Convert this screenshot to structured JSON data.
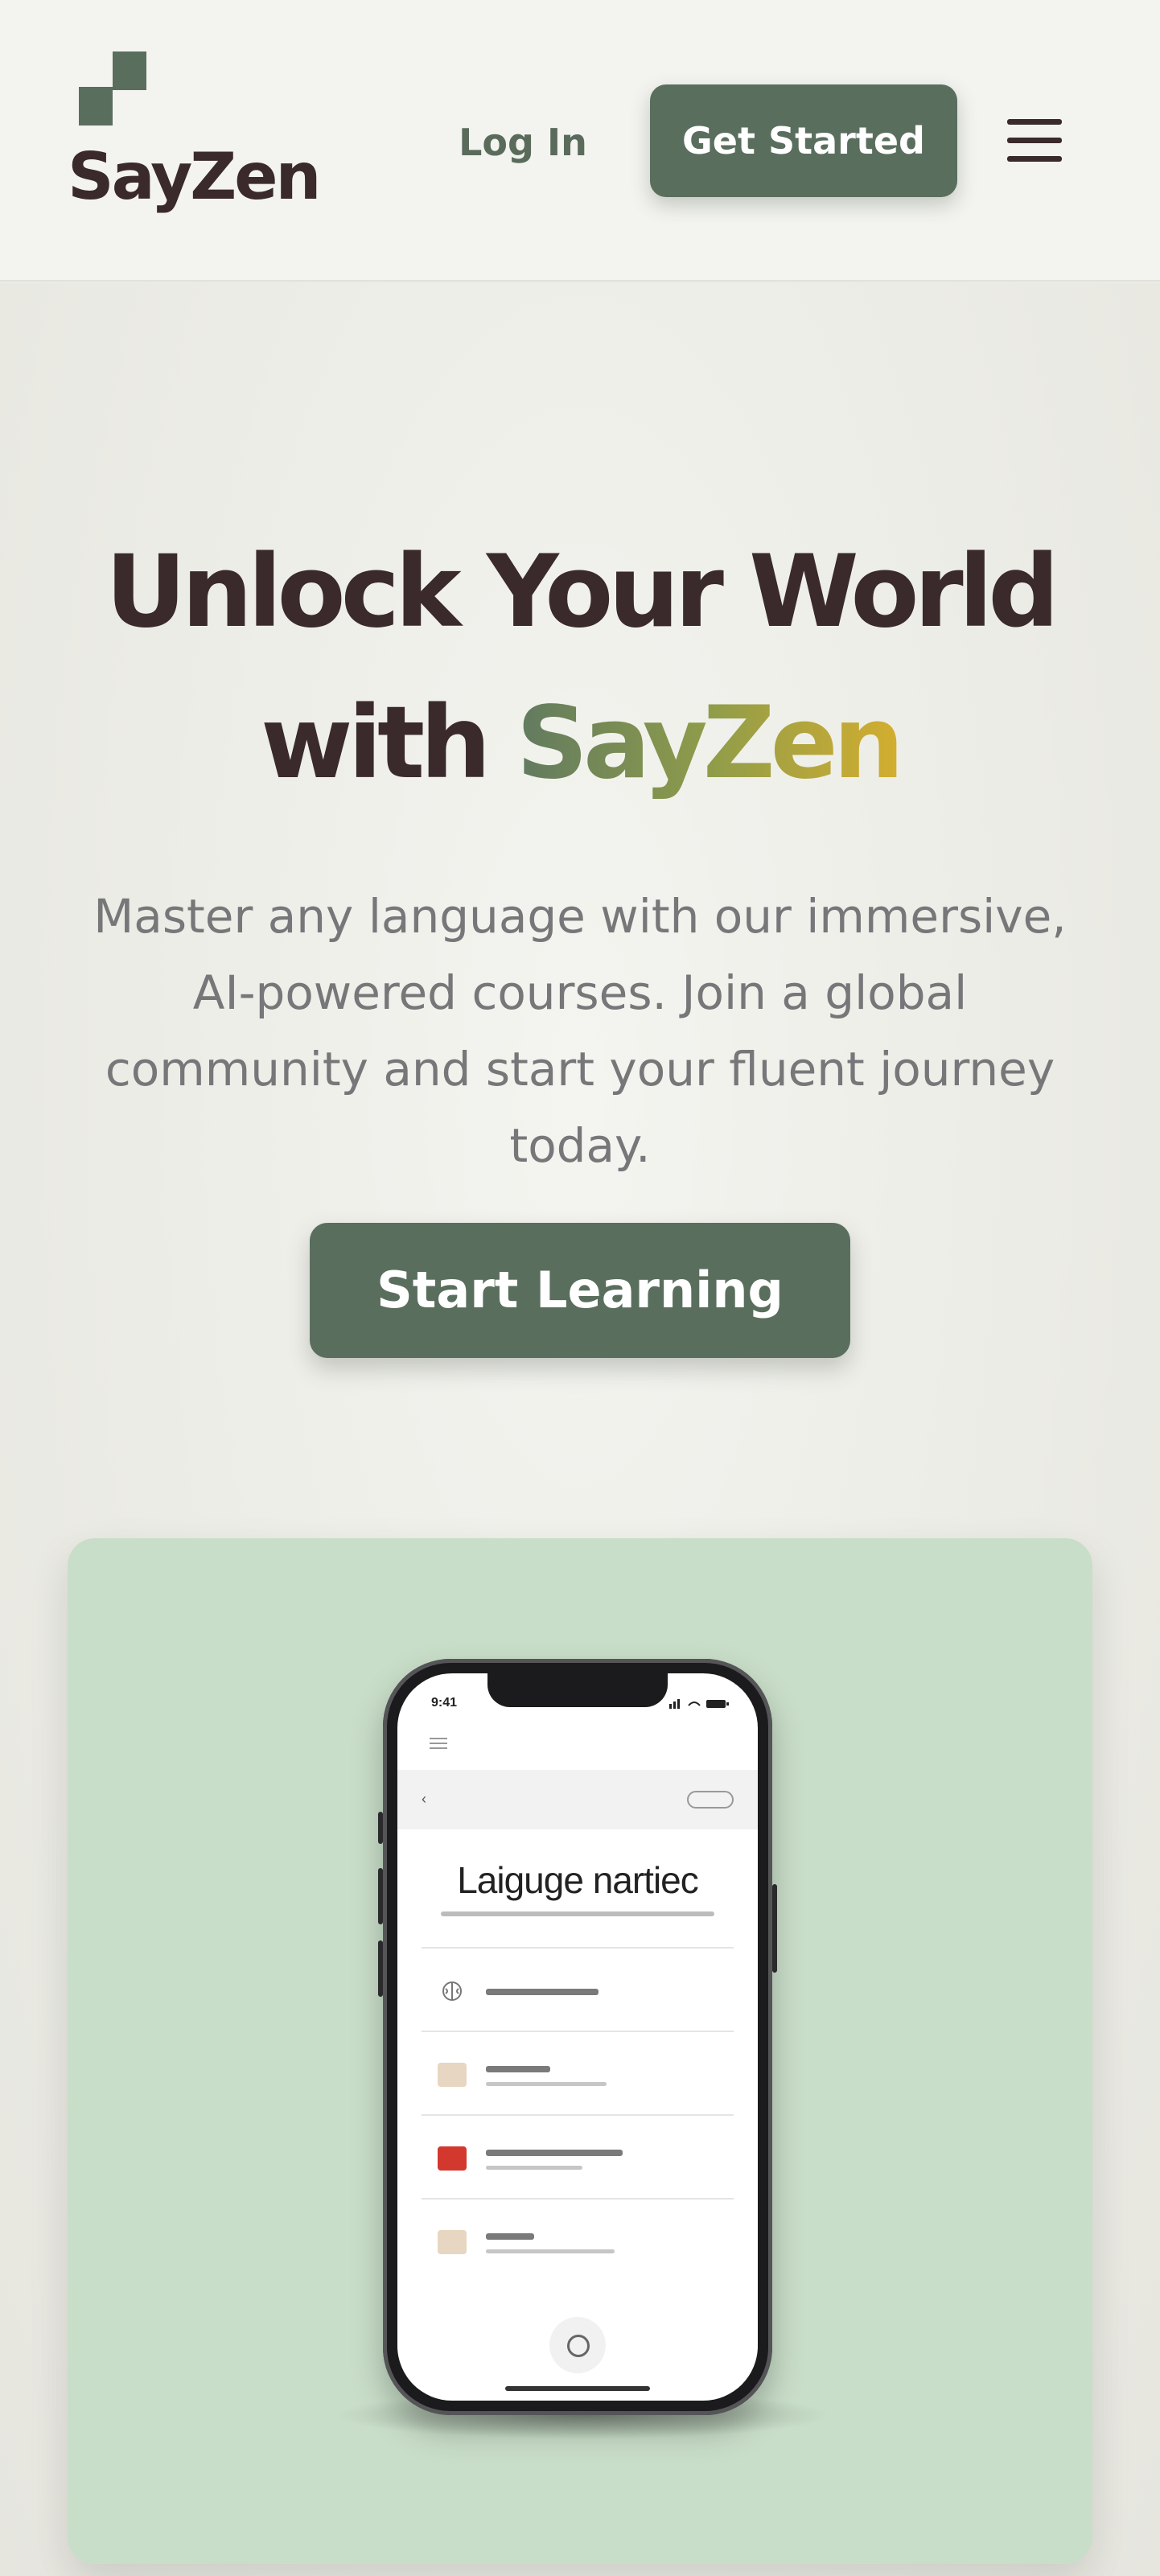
{
  "brand": {
    "name": "SayZen",
    "accent": "#5a6e5e",
    "gradient": [
      "#617a60",
      "#d3ae2f"
    ]
  },
  "header": {
    "login_label": "Log In",
    "cta_label": "Get Started",
    "menu_icon": "hamburger-icon"
  },
  "hero": {
    "title_line1": "Unlock Your World",
    "title_with": "with",
    "title_brand": "SayZen",
    "subtitle": "Master any language with our immersive, AI-powered courses. Join a global community and start your fluent journey today.",
    "cta_label": "Start Learning"
  },
  "phone_mockup": {
    "screen_title": "Laiguge nartiec"
  }
}
